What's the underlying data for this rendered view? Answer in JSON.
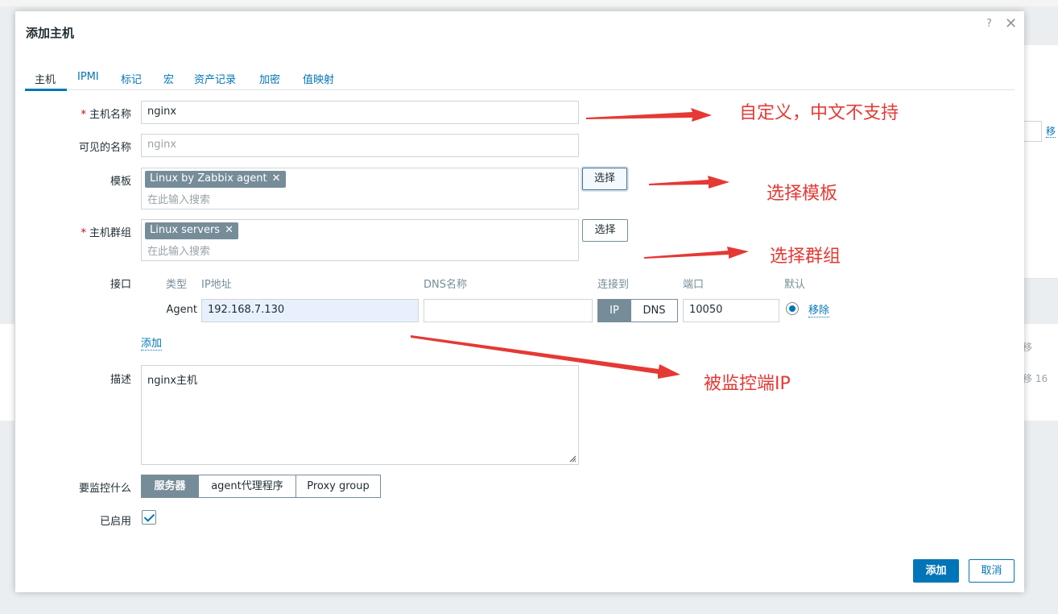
{
  "background": {
    "remove_link": "移",
    "col_partial": "移",
    "row_partial": "移 16"
  },
  "dialog": {
    "title": "添加主机",
    "help": "?",
    "close": "✕"
  },
  "tabs": [
    {
      "label": "主机"
    },
    {
      "label": "IPMI"
    },
    {
      "label": "标记"
    },
    {
      "label": "宏"
    },
    {
      "label": "资产记录"
    },
    {
      "label": "加密"
    },
    {
      "label": "值映射"
    }
  ],
  "form": {
    "required_mark": "*",
    "host_name": {
      "label": "主机名称",
      "value": "nginx"
    },
    "visible_name": {
      "label": "可见的名称",
      "placeholder": "nginx"
    },
    "templates": {
      "label": "模板",
      "chip": "Linux by Zabbix agent",
      "chip_remove": "✕",
      "search_placeholder": "在此输入搜索",
      "select_label": "选择"
    },
    "host_groups": {
      "label": "主机群组",
      "chip": "Linux servers",
      "chip_remove": "✕",
      "search_placeholder": "在此输入搜索",
      "select_label": "选择"
    },
    "interfaces": {
      "label": "接口",
      "headers": {
        "type": "类型",
        "ip": "IP地址",
        "dns": "DNS名称",
        "connect_to": "连接到",
        "port": "端口",
        "default": "默认"
      },
      "rows": [
        {
          "type": "Agent",
          "ip": "192.168.7.130",
          "dns": "",
          "connect_ip": "IP",
          "connect_dns": "DNS",
          "port": "10050",
          "remove": "移除"
        }
      ],
      "add_link": "添加"
    },
    "description": {
      "label": "描述",
      "value": "nginx主机"
    },
    "monitored_by": {
      "label": "要监控什么",
      "options": [
        "服务器",
        "agent代理程序",
        "Proxy group"
      ],
      "selected": "服务器"
    },
    "enabled": {
      "label": "已启用",
      "checked": true
    }
  },
  "footer": {
    "add_label": "添加",
    "cancel_label": "取消"
  },
  "annotations": {
    "note1": "自定义，中文不支持",
    "note2": "选择模板",
    "note3": "选择群组",
    "note4": "被监控端IP",
    "color": "#e53935"
  },
  "colors": {
    "accent": "#0275b8",
    "chip": "#768d99"
  }
}
